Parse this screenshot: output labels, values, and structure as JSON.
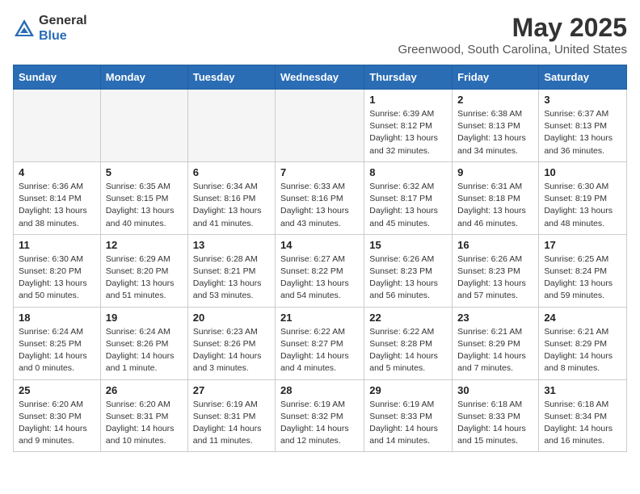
{
  "logo": {
    "general": "General",
    "blue": "Blue"
  },
  "title": "May 2025",
  "subtitle": "Greenwood, South Carolina, United States",
  "days_of_week": [
    "Sunday",
    "Monday",
    "Tuesday",
    "Wednesday",
    "Thursday",
    "Friday",
    "Saturday"
  ],
  "weeks": [
    [
      {
        "day": "",
        "info": ""
      },
      {
        "day": "",
        "info": ""
      },
      {
        "day": "",
        "info": ""
      },
      {
        "day": "",
        "info": ""
      },
      {
        "day": "1",
        "info": "Sunrise: 6:39 AM\nSunset: 8:12 PM\nDaylight: 13 hours and 32 minutes."
      },
      {
        "day": "2",
        "info": "Sunrise: 6:38 AM\nSunset: 8:13 PM\nDaylight: 13 hours and 34 minutes."
      },
      {
        "day": "3",
        "info": "Sunrise: 6:37 AM\nSunset: 8:13 PM\nDaylight: 13 hours and 36 minutes."
      }
    ],
    [
      {
        "day": "4",
        "info": "Sunrise: 6:36 AM\nSunset: 8:14 PM\nDaylight: 13 hours and 38 minutes."
      },
      {
        "day": "5",
        "info": "Sunrise: 6:35 AM\nSunset: 8:15 PM\nDaylight: 13 hours and 40 minutes."
      },
      {
        "day": "6",
        "info": "Sunrise: 6:34 AM\nSunset: 8:16 PM\nDaylight: 13 hours and 41 minutes."
      },
      {
        "day": "7",
        "info": "Sunrise: 6:33 AM\nSunset: 8:16 PM\nDaylight: 13 hours and 43 minutes."
      },
      {
        "day": "8",
        "info": "Sunrise: 6:32 AM\nSunset: 8:17 PM\nDaylight: 13 hours and 45 minutes."
      },
      {
        "day": "9",
        "info": "Sunrise: 6:31 AM\nSunset: 8:18 PM\nDaylight: 13 hours and 46 minutes."
      },
      {
        "day": "10",
        "info": "Sunrise: 6:30 AM\nSunset: 8:19 PM\nDaylight: 13 hours and 48 minutes."
      }
    ],
    [
      {
        "day": "11",
        "info": "Sunrise: 6:30 AM\nSunset: 8:20 PM\nDaylight: 13 hours and 50 minutes."
      },
      {
        "day": "12",
        "info": "Sunrise: 6:29 AM\nSunset: 8:20 PM\nDaylight: 13 hours and 51 minutes."
      },
      {
        "day": "13",
        "info": "Sunrise: 6:28 AM\nSunset: 8:21 PM\nDaylight: 13 hours and 53 minutes."
      },
      {
        "day": "14",
        "info": "Sunrise: 6:27 AM\nSunset: 8:22 PM\nDaylight: 13 hours and 54 minutes."
      },
      {
        "day": "15",
        "info": "Sunrise: 6:26 AM\nSunset: 8:23 PM\nDaylight: 13 hours and 56 minutes."
      },
      {
        "day": "16",
        "info": "Sunrise: 6:26 AM\nSunset: 8:23 PM\nDaylight: 13 hours and 57 minutes."
      },
      {
        "day": "17",
        "info": "Sunrise: 6:25 AM\nSunset: 8:24 PM\nDaylight: 13 hours and 59 minutes."
      }
    ],
    [
      {
        "day": "18",
        "info": "Sunrise: 6:24 AM\nSunset: 8:25 PM\nDaylight: 14 hours and 0 minutes."
      },
      {
        "day": "19",
        "info": "Sunrise: 6:24 AM\nSunset: 8:26 PM\nDaylight: 14 hours and 1 minute."
      },
      {
        "day": "20",
        "info": "Sunrise: 6:23 AM\nSunset: 8:26 PM\nDaylight: 14 hours and 3 minutes."
      },
      {
        "day": "21",
        "info": "Sunrise: 6:22 AM\nSunset: 8:27 PM\nDaylight: 14 hours and 4 minutes."
      },
      {
        "day": "22",
        "info": "Sunrise: 6:22 AM\nSunset: 8:28 PM\nDaylight: 14 hours and 5 minutes."
      },
      {
        "day": "23",
        "info": "Sunrise: 6:21 AM\nSunset: 8:29 PM\nDaylight: 14 hours and 7 minutes."
      },
      {
        "day": "24",
        "info": "Sunrise: 6:21 AM\nSunset: 8:29 PM\nDaylight: 14 hours and 8 minutes."
      }
    ],
    [
      {
        "day": "25",
        "info": "Sunrise: 6:20 AM\nSunset: 8:30 PM\nDaylight: 14 hours and 9 minutes."
      },
      {
        "day": "26",
        "info": "Sunrise: 6:20 AM\nSunset: 8:31 PM\nDaylight: 14 hours and 10 minutes."
      },
      {
        "day": "27",
        "info": "Sunrise: 6:19 AM\nSunset: 8:31 PM\nDaylight: 14 hours and 11 minutes."
      },
      {
        "day": "28",
        "info": "Sunrise: 6:19 AM\nSunset: 8:32 PM\nDaylight: 14 hours and 12 minutes."
      },
      {
        "day": "29",
        "info": "Sunrise: 6:19 AM\nSunset: 8:33 PM\nDaylight: 14 hours and 14 minutes."
      },
      {
        "day": "30",
        "info": "Sunrise: 6:18 AM\nSunset: 8:33 PM\nDaylight: 14 hours and 15 minutes."
      },
      {
        "day": "31",
        "info": "Sunrise: 6:18 AM\nSunset: 8:34 PM\nDaylight: 14 hours and 16 minutes."
      }
    ]
  ]
}
